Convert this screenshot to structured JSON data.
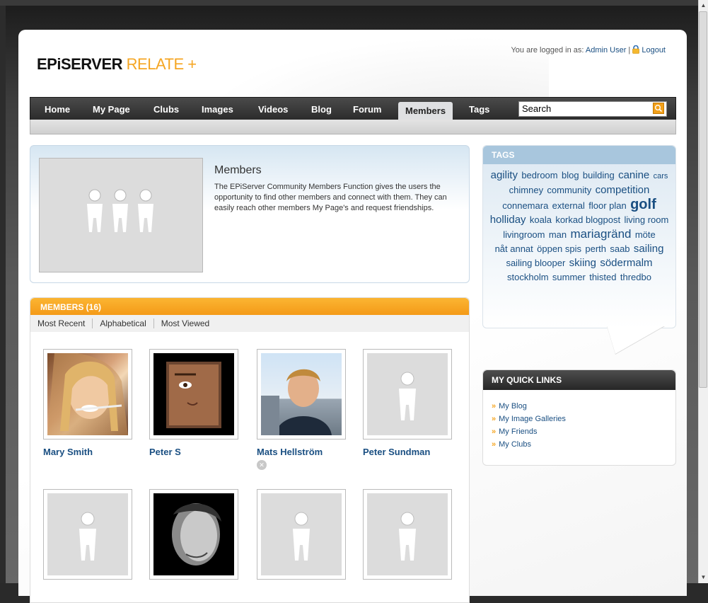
{
  "header": {
    "logo_dark": "EPiSERVER",
    "logo_orange": "RELATE +",
    "logged_in_prefix": "You are logged in as:",
    "user": "Admin User",
    "separator": "|",
    "logout": "Logout"
  },
  "nav": {
    "items": [
      "Home",
      "My Page",
      "Clubs",
      "Images",
      "Videos",
      "Blog",
      "Forum",
      "Members",
      "Tags"
    ],
    "active": "Members",
    "search_value": "Search"
  },
  "intro": {
    "title": "Members",
    "text": "The EPiServer Community Members Function gives the users the opportunity to find other members and connect with them. They can easily reach other members My Page's and request friendships."
  },
  "members": {
    "header": "MEMBERS (16)",
    "sort": [
      "Most Recent",
      "Alphabetical",
      "Most Viewed"
    ],
    "list": [
      {
        "name": "Mary Smith"
      },
      {
        "name": "Peter S"
      },
      {
        "name": "Mats Hellström"
      },
      {
        "name": "Peter Sundman"
      },
      {
        "name": ""
      },
      {
        "name": ""
      },
      {
        "name": ""
      },
      {
        "name": ""
      }
    ]
  },
  "tags": {
    "header": "TAGS",
    "cloud": [
      {
        "t": "agility",
        "s": 3
      },
      {
        "t": "bedroom",
        "s": 2
      },
      {
        "t": "blog",
        "s": 2
      },
      {
        "t": "building",
        "s": 2
      },
      {
        "t": "canine",
        "s": 3
      },
      {
        "t": "cars",
        "s": 1
      },
      {
        "t": "chimney",
        "s": 2
      },
      {
        "t": "community",
        "s": 2
      },
      {
        "t": "competition",
        "s": 3
      },
      {
        "t": "connemara",
        "s": 2
      },
      {
        "t": "external",
        "s": 2
      },
      {
        "t": "floor plan",
        "s": 2
      },
      {
        "t": "golf",
        "s": 5
      },
      {
        "t": "holliday",
        "s": 3
      },
      {
        "t": "koala",
        "s": 2
      },
      {
        "t": "korkad blogpost",
        "s": 2
      },
      {
        "t": "living room",
        "s": 2
      },
      {
        "t": "livingroom",
        "s": 2
      },
      {
        "t": "man",
        "s": 2
      },
      {
        "t": "mariagränd",
        "s": 4
      },
      {
        "t": "möte",
        "s": 2
      },
      {
        "t": "nåt annat",
        "s": 2
      },
      {
        "t": "öppen spis",
        "s": 2
      },
      {
        "t": "perth",
        "s": 2
      },
      {
        "t": "saab",
        "s": 2
      },
      {
        "t": "sailing",
        "s": 3
      },
      {
        "t": "sailing blooper",
        "s": 2
      },
      {
        "t": "skiing",
        "s": 3
      },
      {
        "t": "södermalm",
        "s": 3
      },
      {
        "t": "stockholm",
        "s": 2
      },
      {
        "t": "summer",
        "s": 2
      },
      {
        "t": "thisted",
        "s": 2
      },
      {
        "t": "thredbo",
        "s": 2
      }
    ]
  },
  "quick_links": {
    "header": "MY QUICK LINKS",
    "items": [
      "My Blog",
      "My Image Galleries",
      "My Friends",
      "My Clubs"
    ]
  }
}
